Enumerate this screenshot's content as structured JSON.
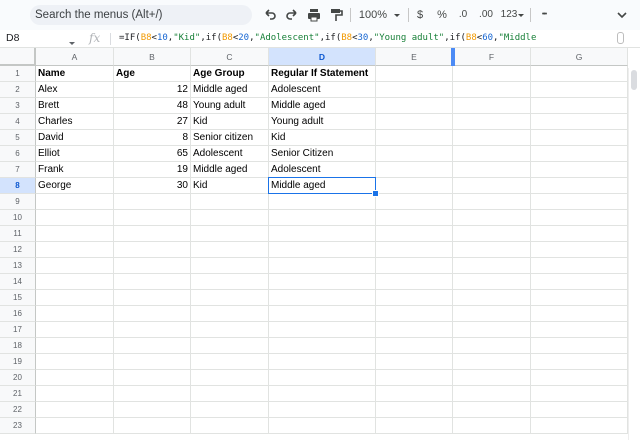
{
  "toolbar": {
    "search_placeholder": "Search the menus (Alt+/)",
    "zoom": "100%",
    "currency_label": "$",
    "percent_label": "%",
    "decrease_decimal": ".0",
    "increase_decimal": ".00",
    "number_format": "123",
    "more_label": "•••"
  },
  "formula_bar": {
    "cell_ref": "D8",
    "fx_label": "fx",
    "formula_parts": [
      {
        "t": "=IF(",
        "k": "plain"
      },
      {
        "t": "B8",
        "k": "ref"
      },
      {
        "t": "<",
        "k": "plain"
      },
      {
        "t": "10",
        "k": "num"
      },
      {
        "t": ",",
        "k": "plain"
      },
      {
        "t": "\"Kid\"",
        "k": "str"
      },
      {
        "t": ",if(",
        "k": "plain"
      },
      {
        "t": "B8",
        "k": "ref"
      },
      {
        "t": "<",
        "k": "plain"
      },
      {
        "t": "20",
        "k": "num"
      },
      {
        "t": ",",
        "k": "plain"
      },
      {
        "t": "\"Adolescent\"",
        "k": "str"
      },
      {
        "t": ",if(",
        "k": "plain"
      },
      {
        "t": "B8",
        "k": "ref"
      },
      {
        "t": "<",
        "k": "plain"
      },
      {
        "t": "30",
        "k": "num"
      },
      {
        "t": ",",
        "k": "plain"
      },
      {
        "t": "\"Young adult\"",
        "k": "str"
      },
      {
        "t": ",if(",
        "k": "plain"
      },
      {
        "t": "B8",
        "k": "ref"
      },
      {
        "t": "<",
        "k": "plain"
      },
      {
        "t": "60",
        "k": "num"
      },
      {
        "t": ",",
        "k": "plain"
      },
      {
        "t": "\"Middle",
        "k": "str"
      }
    ]
  },
  "sheet": {
    "columns": [
      "A",
      "B",
      "C",
      "D",
      "E",
      "F",
      "G"
    ],
    "selected_column": "D",
    "selected_row": 8,
    "rows": [
      [
        "Name",
        "Age",
        "Age Group",
        "Regular If Statement"
      ],
      [
        "Alex",
        "12",
        "Middle aged",
        "Adolescent"
      ],
      [
        "Brett",
        "48",
        "Young adult",
        "Middle aged"
      ],
      [
        "Charles",
        "27",
        "Kid",
        "Young adult"
      ],
      [
        "David",
        "8",
        "Senior citizen",
        "Kid"
      ],
      [
        "Elliot",
        "65",
        "Adolescent",
        "Senior Citizen"
      ],
      [
        "Frank",
        "19",
        "Middle aged",
        "Adolescent"
      ],
      [
        "George",
        "30",
        "Kid",
        "Middle aged"
      ]
    ],
    "row_numbers": [
      "1",
      "2",
      "3",
      "4",
      "5",
      "6",
      "7",
      "8",
      "9",
      "10",
      "11",
      "12",
      "13",
      "14",
      "15",
      "16",
      "17",
      "18",
      "19",
      "20",
      "21",
      "22",
      "23"
    ]
  },
  "colors": {
    "selection": "#1a73e8",
    "header_selected_bg": "#d3e3fd",
    "formula_ref": "#f29900",
    "formula_string": "#188038",
    "formula_number": "#1967d2"
  }
}
